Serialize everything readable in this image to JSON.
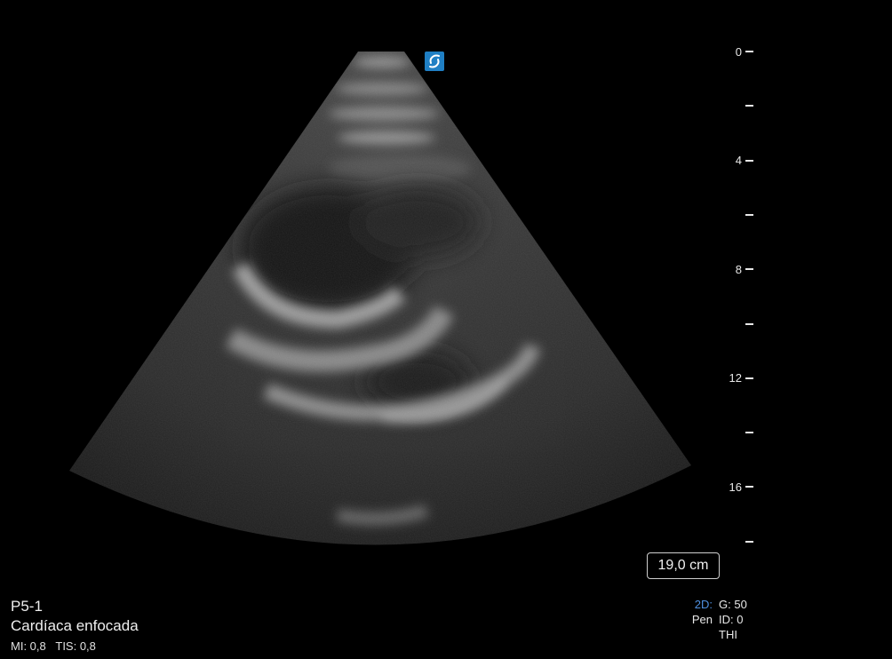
{
  "probe": "P5-1",
  "preset": "Cardíaca enfocada",
  "indices": {
    "mi": "MI: 0,8",
    "tis": "TIS: 0,8"
  },
  "depth": {
    "value_label": "19,0 cm",
    "ticks": [
      {
        "label": "0"
      },
      {
        "label": ""
      },
      {
        "label": "4"
      },
      {
        "label": ""
      },
      {
        "label": "8"
      },
      {
        "label": ""
      },
      {
        "label": "12"
      },
      {
        "label": ""
      },
      {
        "label": "16"
      },
      {
        "label": ""
      }
    ]
  },
  "imaging_params": {
    "mode": "2D:",
    "gain": "G: 50",
    "freq": "Pen",
    "dynamic": "ID: 0",
    "harmonic": "THI"
  },
  "colors": {
    "background": "#000000",
    "text": "#e8e8e8",
    "mode_accent": "#4f90e0",
    "marker": "#1f7fc4"
  },
  "icons": {
    "orientation_marker": "orientation-marker-icon"
  }
}
